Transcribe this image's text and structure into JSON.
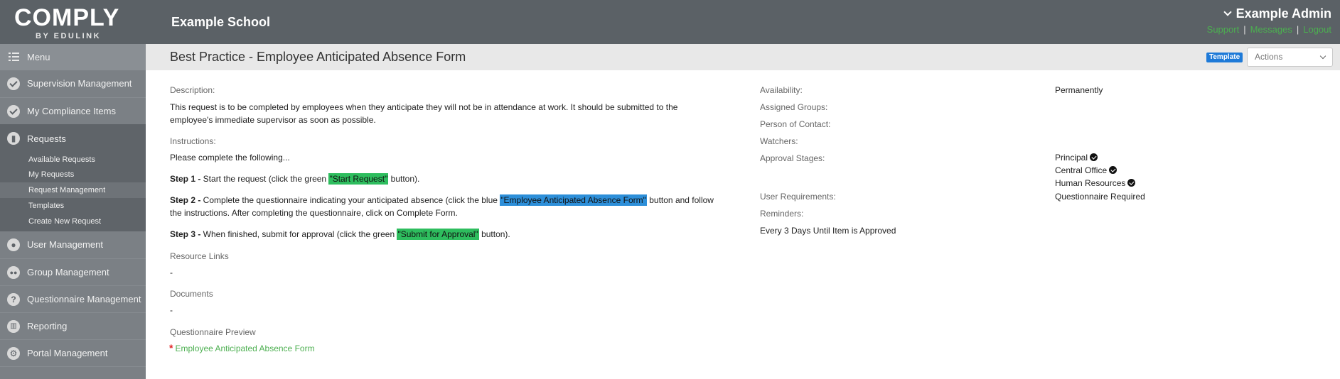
{
  "header": {
    "logo_text": "COMPLY",
    "logo_sub": "BY EDULINK",
    "school_name": "Example School",
    "admin_name": "Example Admin",
    "links": [
      "Support",
      "Messages",
      "Logout"
    ]
  },
  "sidebar": {
    "menu_label": "Menu",
    "items": [
      {
        "label": "Supervision Management",
        "icon": "check-circle-icon"
      },
      {
        "label": "My Compliance Items",
        "icon": "check-circle-icon"
      },
      {
        "label": "Requests",
        "icon": "clipboard-icon"
      },
      {
        "label": "User Management",
        "icon": "user-icon"
      },
      {
        "label": "Group Management",
        "icon": "group-icon"
      },
      {
        "label": "Questionnaire Management",
        "icon": "question-icon"
      },
      {
        "label": "Reporting",
        "icon": "chart-icon"
      },
      {
        "label": "Portal Management",
        "icon": "gear-icon"
      }
    ],
    "request_subitems": [
      "Available Requests",
      "My Requests",
      "Request Management",
      "Templates",
      "Create New Request"
    ],
    "active_subitem": "Request Management"
  },
  "main": {
    "title": "Best Practice - Employee Anticipated Absence Form",
    "template_badge": "Template",
    "actions_label": "Actions",
    "description_label": "Description:",
    "description_line1": "This request is to be completed by employees when they anticipate they will not be in attendance at work. It should be submitted to the",
    "description_line2": "employee's immediate supervisor as soon as possible.",
    "instructions_label": "Instructions:",
    "instructions_intro": "Please complete the following...",
    "step1": {
      "label": "Step 1 -",
      "before": " Start the request (click the green ",
      "highlight": "\"Start Request\"",
      "after": " button)."
    },
    "step2": {
      "label": "Step 2 -",
      "before": " Complete the questionnaire indicating your anticipated absence (click the blue ",
      "highlight": "\"Employee Anticipated Absence Form\"",
      "after": " button and follow",
      "line2": "the instructions. After completing the questionnaire, click on Complete Form."
    },
    "step3": {
      "label": "Step 3 -",
      "before": " When finished, submit for approval (click the green ",
      "highlight": "\"Submit for Approval\"",
      "after": " button)."
    },
    "resource_links_label": "Resource Links",
    "resource_links_value": "-",
    "documents_label": "Documents",
    "documents_value": "-",
    "questionnaire_preview_label": "Questionnaire Preview",
    "questionnaire_link": "Employee Anticipated Absence Form",
    "details": {
      "availability_label": "Availability:",
      "availability_value": "Permanently",
      "assigned_groups_label": "Assigned Groups:",
      "person_of_contact_label": "Person of Contact:",
      "watchers_label": "Watchers:",
      "approval_stages_label": "Approval Stages:",
      "approval_stages": [
        "Principal",
        "Central Office",
        "Human Resources"
      ],
      "user_requirements_label": "User Requirements:",
      "user_requirements_value": "Questionnaire Required",
      "reminders_label": "Reminders:",
      "reminders_value": "Every 3 Days Until Item is Approved"
    }
  },
  "colors": {
    "topbar": "#5b6166",
    "sidebar": "#5f6469",
    "link_green": "#4caf50",
    "highlight_green": "#2ebd5e",
    "highlight_blue": "#2d8fd9",
    "badge_blue": "#1e7ad8"
  }
}
